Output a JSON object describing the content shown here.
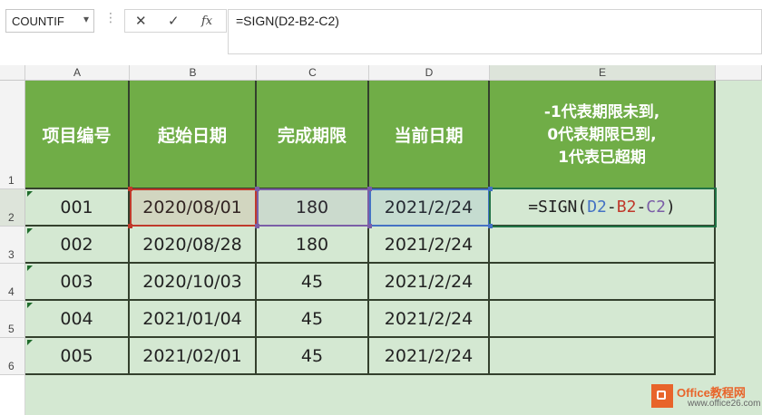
{
  "name_box": {
    "value": "COUNTIF"
  },
  "formula_bar": {
    "cancel_icon": "✕",
    "enter_icon": "✓",
    "fx_icon": "fx",
    "formula": "=SIGN(D2-B2-C2)"
  },
  "columns": [
    "A",
    "B",
    "C",
    "D",
    "E"
  ],
  "rows": [
    "1",
    "2",
    "3",
    "4",
    "5",
    "6"
  ],
  "header": {
    "a": "项目编号",
    "b": "起始日期",
    "c": "完成期限",
    "d": "当前日期",
    "e": "-1代表期限未到,\n0代表期限已到,\n1代表已超期"
  },
  "data_rows": [
    {
      "a": "001",
      "b": "2020/08/01",
      "c": "180",
      "d": "2021/2/24",
      "e": ""
    },
    {
      "a": "002",
      "b": "2020/08/28",
      "c": "180",
      "d": "2021/2/24",
      "e": ""
    },
    {
      "a": "003",
      "b": "2020/10/03",
      "c": "45",
      "d": "2021/2/24",
      "e": ""
    },
    {
      "a": "004",
      "b": "2021/01/04",
      "c": "45",
      "d": "2021/2/24",
      "e": ""
    },
    {
      "a": "005",
      "b": "2021/02/01",
      "c": "45",
      "d": "2021/2/24",
      "e": ""
    }
  ],
  "active_cell_formula": {
    "prefix": "=SIGN(",
    "ref_d": "D2",
    "minus1": "-",
    "ref_b": "B2",
    "minus2": "-",
    "ref_c": "C2",
    "suffix": ")"
  },
  "colors": {
    "header_fill": "#70ad47",
    "cell_fill": "#d4e8d2",
    "ref_d": "#4472c4",
    "ref_b": "#c0392b",
    "ref_c": "#7b5ea7",
    "active_border": "#217346"
  },
  "watermark": {
    "line1": "Office教程网",
    "line2": "www.office26.com"
  }
}
